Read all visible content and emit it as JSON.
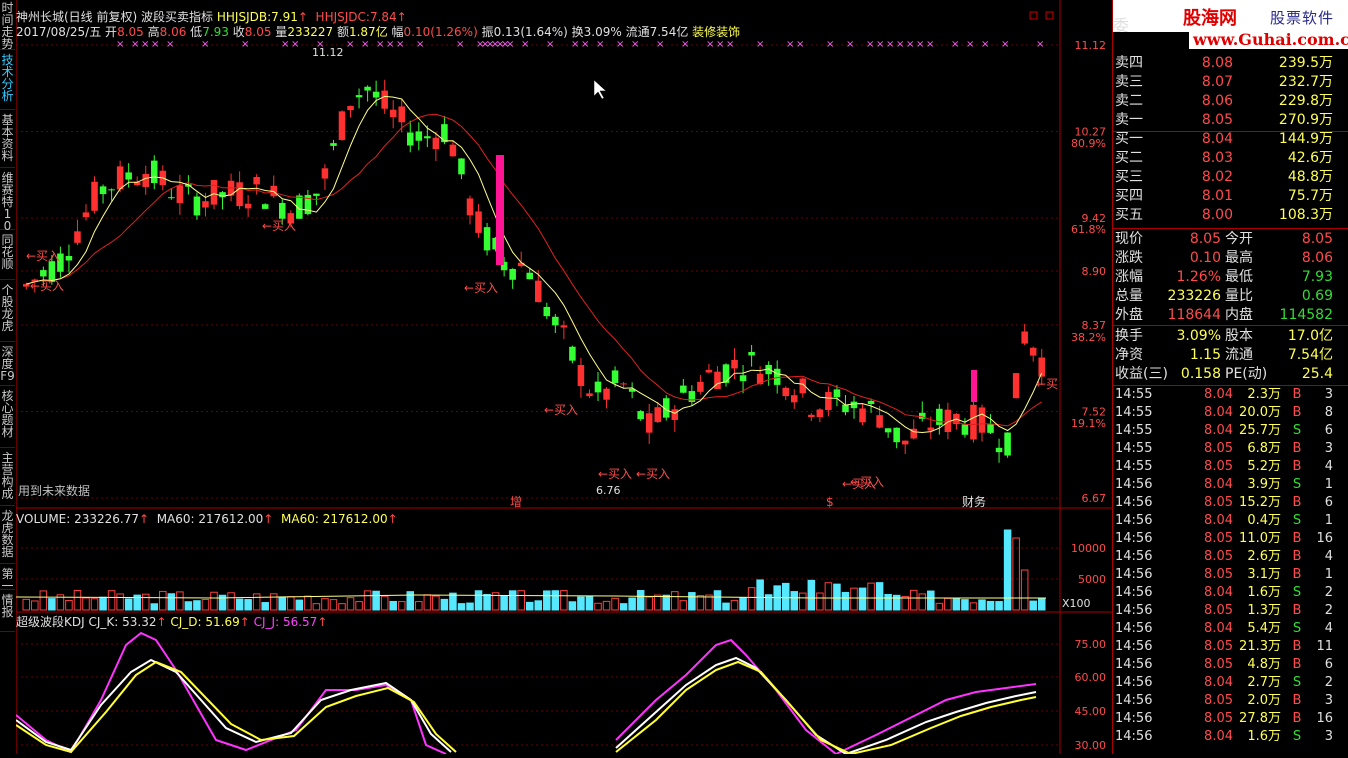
{
  "left_tabs": [
    "时间走势",
    "技术分析",
    "基本资料",
    "维赛特10",
    "同花顺",
    "个股龙虎",
    "深度F9",
    "核心题材",
    "主营构成",
    "龙虎数据",
    "第一",
    "情报"
  ],
  "header": {
    "title": "神州长城(日线 前复权)",
    "indicator": "波段买卖指标",
    "hhjsjdb_label": "HHJSJDB:",
    "hhjsjdb_value": "7.91",
    "hhjsjdc_label": "HHJSJDC:",
    "hhjsjdc_value": "7.84",
    "date": "2017/08/25/五",
    "open_label": "开",
    "open": "8.05",
    "high_label": "高",
    "high": "8.06",
    "low_label": "低",
    "low": "7.93",
    "close_label": "收",
    "close": "8.05",
    "vol_label": "量",
    "vol": "233227",
    "amount_label": "额",
    "amount": "1.87亿",
    "change_label": "幅",
    "change": "0.10(1.26%)",
    "amplitude_label": "振",
    "amplitude": "0.13(1.64%)",
    "turnover_label": "换",
    "turnover": "3.09%",
    "float_label": "流通",
    "float": "7.54亿",
    "sector": "装修装饰"
  },
  "main_chart": {
    "y_ticks": [
      "11.12",
      "10.27",
      "9.42",
      "8.90",
      "8.37",
      "7.52",
      "6.67"
    ],
    "pct_ticks": [
      "80.9%",
      "61.8%",
      "38.2%",
      "19.1%"
    ],
    "high_label": "11.12",
    "low_label": "6.76",
    "buy_label": "←买入",
    "buy_label_right": "←买",
    "markers": [
      "增",
      "$",
      "财务"
    ],
    "footer_note": "用到未来数据"
  },
  "volume_panel": {
    "title": "VOLUME: 233226.77",
    "ma1": "MA60: 217612.00",
    "ma2": "MA60: 217612.00",
    "y_ticks": [
      "10000",
      "5000"
    ],
    "unit": "X100"
  },
  "kdj_panel": {
    "title": "超级波段KDJ",
    "k": "CJ_K: 53.32",
    "d": "CJ_D: 51.69",
    "j": "CJ_J: 56.57",
    "y_ticks": [
      "75.00",
      "60.00",
      "45.00",
      "30.00"
    ]
  },
  "brand": {
    "cap": "委",
    "name": "股海网",
    "slogan": "股票软件资源分享",
    "url": "www.Guhai.com.cn"
  },
  "order_book": [
    {
      "label": "卖四",
      "price": "8.08",
      "vol": "239.5万"
    },
    {
      "label": "卖三",
      "price": "8.07",
      "vol": "232.7万"
    },
    {
      "label": "卖二",
      "price": "8.06",
      "vol": "229.8万"
    },
    {
      "label": "卖一",
      "price": "8.05",
      "vol": "270.9万"
    },
    {
      "label": "买一",
      "price": "8.04",
      "vol": "144.9万"
    },
    {
      "label": "买二",
      "price": "8.03",
      "vol": "42.6万"
    },
    {
      "label": "买三",
      "price": "8.02",
      "vol": "48.8万"
    },
    {
      "label": "买四",
      "price": "8.01",
      "vol": "75.7万"
    },
    {
      "label": "买五",
      "price": "8.00",
      "vol": "108.3万"
    }
  ],
  "quote": [
    {
      "l1": "现价",
      "v1": "8.05",
      "c1": "#ff4b4b",
      "l2": "今开",
      "v2": "8.05",
      "c2": "#ff4b4b"
    },
    {
      "l1": "涨跌",
      "v1": "0.10",
      "c1": "#ff4b4b",
      "l2": "最高",
      "v2": "8.06",
      "c2": "#ff4b4b"
    },
    {
      "l1": "涨幅",
      "v1": "1.26%",
      "c1": "#ff4b4b",
      "l2": "最低",
      "v2": "7.93",
      "c2": "#33dd33"
    },
    {
      "l1": "总量",
      "v1": "233226",
      "c1": "#ffff55",
      "l2": "量比",
      "v2": "0.69",
      "c2": "#33dd33"
    },
    {
      "l1": "外盘",
      "v1": "118644",
      "c1": "#ff4b4b",
      "l2": "内盘",
      "v2": "114582",
      "c2": "#33dd33"
    },
    {
      "l1": "换手",
      "v1": "3.09%",
      "c1": "#ffff55",
      "l2": "股本",
      "v2": "17.0亿",
      "c2": "#ffff55"
    },
    {
      "l1": "净资",
      "v1": "1.15",
      "c1": "#ffff55",
      "l2": "流通",
      "v2": "7.54亿",
      "c2": "#ffff55"
    },
    {
      "l1": "收益(三)",
      "v1": "0.158",
      "c1": "#ffff55",
      "l2": "PE(动)",
      "v2": "25.4",
      "c2": "#ffff55"
    }
  ],
  "ticks": [
    {
      "t": "14:55",
      "p": "8.04",
      "pc": "#ff4b4b",
      "v": "2.3万",
      "f": "B",
      "fc": "#ff4b4b",
      "n": "3"
    },
    {
      "t": "14:55",
      "p": "8.04",
      "pc": "#ff4b4b",
      "v": "20.0万",
      "f": "B",
      "fc": "#ff4b4b",
      "n": "8"
    },
    {
      "t": "14:55",
      "p": "8.04",
      "pc": "#ff4b4b",
      "v": "25.7万",
      "f": "S",
      "fc": "#33dd33",
      "n": "6"
    },
    {
      "t": "14:55",
      "p": "8.05",
      "pc": "#ff4b4b",
      "v": "6.8万",
      "f": "B",
      "fc": "#ff4b4b",
      "n": "3"
    },
    {
      "t": "14:55",
      "p": "8.05",
      "pc": "#ff4b4b",
      "v": "5.2万",
      "f": "B",
      "fc": "#ff4b4b",
      "n": "4"
    },
    {
      "t": "14:56",
      "p": "8.04",
      "pc": "#ff4b4b",
      "v": "3.9万",
      "f": "S",
      "fc": "#33dd33",
      "n": "1"
    },
    {
      "t": "14:56",
      "p": "8.05",
      "pc": "#ff4b4b",
      "v": "15.2万",
      "f": "B",
      "fc": "#ff4b4b",
      "n": "6"
    },
    {
      "t": "14:56",
      "p": "8.04",
      "pc": "#ff4b4b",
      "v": "0.4万",
      "f": "S",
      "fc": "#33dd33",
      "n": "1"
    },
    {
      "t": "14:56",
      "p": "8.05",
      "pc": "#ff4b4b",
      "v": "11.0万",
      "f": "B",
      "fc": "#ff4b4b",
      "n": "16"
    },
    {
      "t": "14:56",
      "p": "8.05",
      "pc": "#ff4b4b",
      "v": "2.6万",
      "f": "B",
      "fc": "#ff4b4b",
      "n": "4"
    },
    {
      "t": "14:56",
      "p": "8.05",
      "pc": "#ff4b4b",
      "v": "3.1万",
      "f": "B",
      "fc": "#ff4b4b",
      "n": "1"
    },
    {
      "t": "14:56",
      "p": "8.04",
      "pc": "#ff4b4b",
      "v": "1.6万",
      "f": "S",
      "fc": "#33dd33",
      "n": "2"
    },
    {
      "t": "14:56",
      "p": "8.05",
      "pc": "#ff4b4b",
      "v": "1.3万",
      "f": "B",
      "fc": "#ff4b4b",
      "n": "2"
    },
    {
      "t": "14:56",
      "p": "8.04",
      "pc": "#ff4b4b",
      "v": "5.4万",
      "f": "S",
      "fc": "#33dd33",
      "n": "4"
    },
    {
      "t": "14:56",
      "p": "8.05",
      "pc": "#ff4b4b",
      "v": "21.3万",
      "f": "B",
      "fc": "#ff4b4b",
      "n": "11"
    },
    {
      "t": "14:56",
      "p": "8.05",
      "pc": "#ff4b4b",
      "v": "4.8万",
      "f": "B",
      "fc": "#ff4b4b",
      "n": "6"
    },
    {
      "t": "14:56",
      "p": "8.04",
      "pc": "#ff4b4b",
      "v": "2.7万",
      "f": "S",
      "fc": "#33dd33",
      "n": "2"
    },
    {
      "t": "14:56",
      "p": "8.05",
      "pc": "#ff4b4b",
      "v": "2.0万",
      "f": "B",
      "fc": "#ff4b4b",
      "n": "3"
    },
    {
      "t": "14:56",
      "p": "8.05",
      "pc": "#ff4b4b",
      "v": "27.8万",
      "f": "B",
      "fc": "#ff4b4b",
      "n": "16"
    },
    {
      "t": "14:56",
      "p": "8.04",
      "pc": "#ff4b4b",
      "v": "1.6万",
      "f": "S",
      "fc": "#33dd33",
      "n": "3"
    }
  ],
  "colors": {
    "up": "#ff3030",
    "down": "#33ff33",
    "ma_short": "#ffff88",
    "ma_long": "#e02020",
    "volume_up": "#ff4040",
    "volume_down": "#55e8ff",
    "k_line": "#ffffff",
    "d_line": "#ffff33",
    "j_line": "#ff33ff",
    "signal_bar": "#ff1493"
  }
}
